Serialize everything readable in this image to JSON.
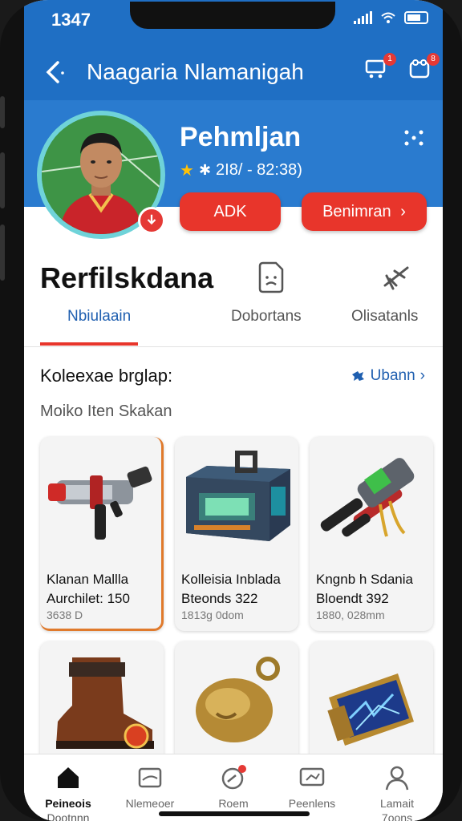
{
  "status": {
    "time": "1347"
  },
  "header": {
    "title": "Naagaria Nlamanigah",
    "cart_badge": "1",
    "profile_badge": "8"
  },
  "profile": {
    "name": "Pehmljan",
    "rating_text": "2I8/ - 82:38)",
    "btn_primary": "ADK",
    "btn_secondary": "Benimran",
    "btn_secondary_chevron": "›"
  },
  "tabs": {
    "big_title": "Rerfilskdana",
    "items": [
      {
        "label": "Nbiulaain",
        "icon": "document-icon"
      },
      {
        "label": "Dobortans",
        "icon": "document-face-icon"
      },
      {
        "label": "Olisatanls",
        "icon": "plane-icon"
      }
    ]
  },
  "section": {
    "title": "Koleexae brglap:",
    "link": "Ubann",
    "subtitle": "Moiko Iten Skakan"
  },
  "items": [
    {
      "name1": "Klanan Mallla",
      "name2": "Aurchilet: 150",
      "meta": "3638 D"
    },
    {
      "name1": "Kolleisia Inblada",
      "name2": "Bteonds 322",
      "meta": "1813g 0dom"
    },
    {
      "name1": "Kngnb h Sdania",
      "name2": "Bloendt 392",
      "meta": "1880, 028mm"
    }
  ],
  "bottom_nav": [
    {
      "label": "Peineois",
      "label2": "Dootnnn",
      "icon": "home-icon"
    },
    {
      "label": "Nlemeoer",
      "icon": "card-icon"
    },
    {
      "label": "Roem",
      "icon": "chat-icon"
    },
    {
      "label": "Peenlens",
      "icon": "message-icon"
    },
    {
      "label": "Lamait",
      "label2": "7oons",
      "icon": "user-icon"
    }
  ],
  "colors": {
    "brand_blue": "#1f6fc4",
    "accent_red": "#e8352b",
    "link_blue": "#1f5fb0"
  }
}
